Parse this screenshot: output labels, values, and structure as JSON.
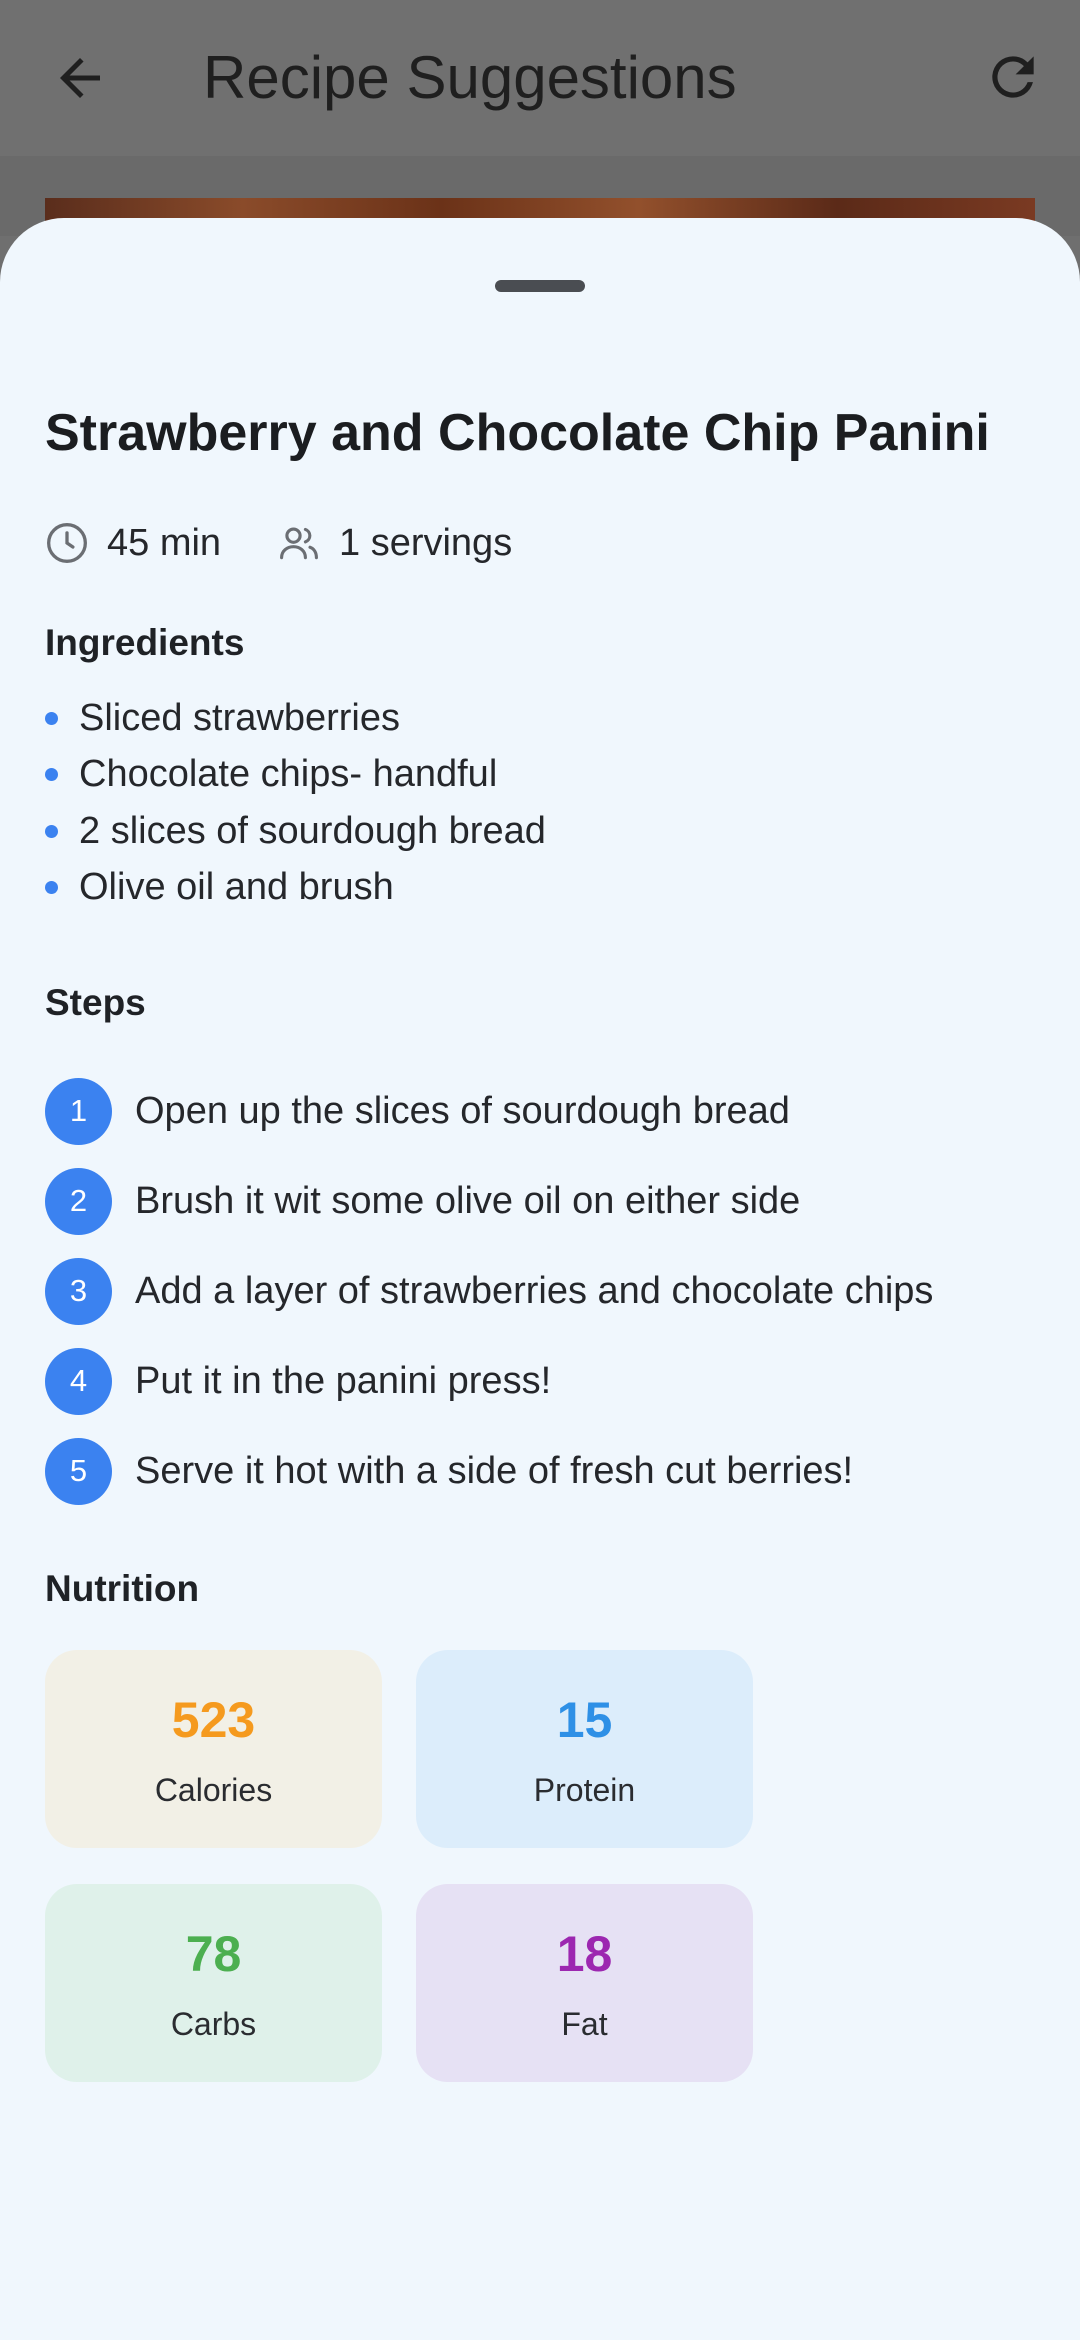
{
  "appbar": {
    "title": "Recipe Suggestions"
  },
  "recipe": {
    "title": "Strawberry and Chocolate Chip Panini",
    "time": "45 min",
    "servings": "1 servings"
  },
  "sections": {
    "ingredients": "Ingredients",
    "steps": "Steps",
    "nutrition": "Nutrition"
  },
  "ingredients": [
    "Sliced strawberries",
    "Chocolate chips- handful",
    "2 slices of sourdough bread",
    "Olive oil and brush"
  ],
  "steps": [
    {
      "n": "1",
      "text": "Open up the slices of sourdough bread"
    },
    {
      "n": "2",
      "text": "Brush it wit some olive oil on either side"
    },
    {
      "n": "3",
      "text": "Add a layer of strawberries and chocolate chips"
    },
    {
      "n": "4",
      "text": "Put it in the panini press!"
    },
    {
      "n": "5",
      "text": "Serve it hot with a side of fresh cut berries!"
    }
  ],
  "nutrition": [
    {
      "value": "523",
      "label": "Calories",
      "color": "#f59a1e",
      "bg": "#f2f0e6"
    },
    {
      "value": "15",
      "label": "Protein",
      "color": "#2e90e6",
      "bg": "#dcedfb"
    },
    {
      "value": "78",
      "label": "Carbs",
      "color": "#4caf50",
      "bg": "#dff1ea"
    },
    {
      "value": "18",
      "label": "Fat",
      "color": "#9c27b0",
      "bg": "#e6e1f4"
    }
  ],
  "colors": {
    "accent": "#3b82f0",
    "sheet_bg": "#f0f7fd"
  },
  "icons": {
    "back": "arrow-left-icon",
    "refresh": "refresh-icon",
    "time": "clock-icon",
    "servings": "people-icon"
  }
}
